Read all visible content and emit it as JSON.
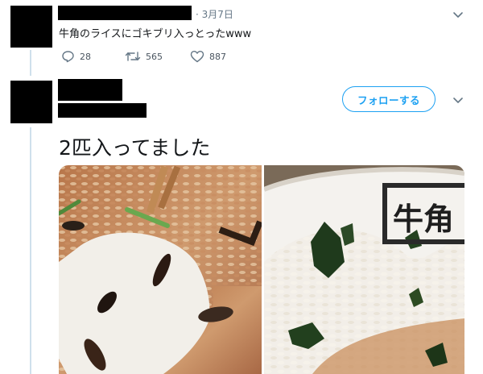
{
  "tweet1": {
    "date": "· 3月7日",
    "text": "牛角のライスにゴキブリ入っとったwww",
    "replies": "28",
    "retweets": "565",
    "likes": "887",
    "icons": {
      "reply": "reply-icon",
      "retweet": "retweet-icon",
      "like": "heart-icon",
      "menu": "chevron-down-icon"
    }
  },
  "tweet2": {
    "follow_label": "フォローする",
    "text": "2匹入ってました",
    "icons": {
      "menu": "chevron-down-icon"
    }
  },
  "photo_right": {
    "bowl_logo": "牛角"
  },
  "colors": {
    "accent": "#1da1f2",
    "thread_line": "#cfe0ec",
    "meta": "#657786"
  }
}
